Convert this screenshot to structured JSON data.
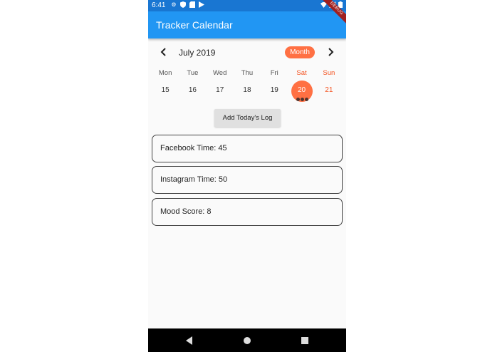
{
  "status_bar": {
    "time": "6:41",
    "left_icons": [
      "settings-icon",
      "shield-icon",
      "sim-card-icon",
      "play-store-icon"
    ],
    "right_icons": [
      "wifi-icon",
      "signal-icon",
      "battery-icon"
    ]
  },
  "app_bar": {
    "title": "Tracker Calendar",
    "debug_banner": "DEBUG"
  },
  "calendar": {
    "month_title": "July 2019",
    "format_button": "Month",
    "weekdays": [
      "Mon",
      "Tue",
      "Wed",
      "Thu",
      "Fri",
      "Sat",
      "Sun"
    ],
    "days": [
      "15",
      "16",
      "17",
      "18",
      "19",
      "20",
      "21"
    ],
    "selected_day": "20",
    "selected_day_event_markers": 3,
    "accent_color": "#ff7043",
    "weekend_color": "#f4511e",
    "marker_color": "#4e342e"
  },
  "add_log_button": "Add Today's Log",
  "logs": [
    "Facebook Time: 45",
    "Instagram Time: 50",
    "Mood Score: 8"
  ],
  "colors": {
    "app_bar": "#2196f3",
    "status_bar": "#1976d2",
    "background": "#fafafa"
  },
  "nav_bar": {
    "buttons": [
      "back-icon",
      "home-icon",
      "recents-icon"
    ]
  }
}
